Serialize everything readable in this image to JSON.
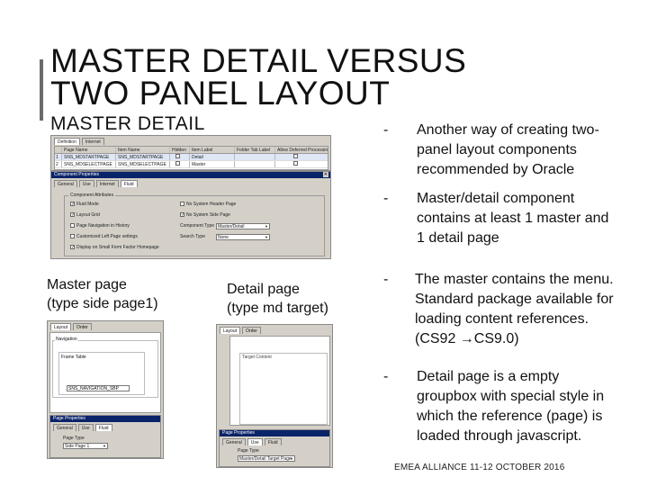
{
  "slide": {
    "title_line1": "MASTER DETAIL VERSUS",
    "title_line2": "TWO PANEL LAYOUT",
    "subtitle": "MASTER DETAIL",
    "footer": "EMEA ALLIANCE   11-12 OCTOBER 2016"
  },
  "screenshot_master": {
    "tabs": [
      "Definition",
      "Internet"
    ],
    "grid_headers": [
      "",
      "Page Name",
      "Item Name",
      "Hidden",
      "Item Label",
      "Folder Tab Label",
      "Allow Deferred Processing"
    ],
    "grid_rows": [
      [
        "1",
        "SNS_MDSTARTPAGE",
        "SNS_MDSTARTPAGE",
        "",
        "Detail",
        "",
        ""
      ],
      [
        "2",
        "SNS_MDSELECTPAGE",
        "SNS_MDSELECTPAGE",
        "",
        "Master",
        "",
        ""
      ]
    ],
    "dialog_title": "Component Properties",
    "dialog_tabs": [
      "General",
      "Use",
      "Internet",
      "Fluid"
    ],
    "group_label": "Component Attributes",
    "left_checks": [
      {
        "label": "Fluid Mode",
        "checked": true
      },
      {
        "label": "Layout Grid",
        "checked": true
      },
      {
        "label": "Page Navigation in History",
        "checked": false
      },
      {
        "label": "Customized Left Page settings",
        "checked": false
      },
      {
        "label": "Display on Small Form Factor Homepage",
        "checked": true
      }
    ],
    "right_checks": [
      {
        "label": "No System Header Page",
        "checked": false
      },
      {
        "label": "No System Side Page",
        "checked": true
      }
    ],
    "component_type_label": "Component Type",
    "component_type_value": "Master/Detail",
    "search_type_label": "Search Type",
    "search_type_value": "None"
  },
  "labels": {
    "master_line1": "Master page",
    "master_line2": "(type side page1)",
    "detail_line1": "Detail page",
    "detail_line2": "(type md target)"
  },
  "thumb_master": {
    "tabs": [
      "Layout",
      "Order"
    ],
    "navigation_label": "Navigation",
    "frame_label": "Frame Table",
    "field_value": "SNS_NAVIGATION_SBP",
    "dialog_title": "Page Properties",
    "dialog_tabs": [
      "General",
      "Use",
      "Fluid"
    ],
    "page_type_label": "Page Type",
    "page_type_value": "Side Page 1"
  },
  "thumb_detail": {
    "tabs": [
      "Layout",
      "Order"
    ],
    "groupbox_label": "Target Content",
    "dialog_title": "Page Properties",
    "dialog_tabs": [
      "General",
      "Use",
      "Fluid"
    ],
    "page_type_label": "Page Type",
    "page_type_value": "Master/Detail Target Page"
  },
  "bullets": [
    {
      "dash": "-",
      "text": "Another way of creating two-panel layout components recommended by Oracle"
    },
    {
      "dash": "-",
      "text": "Master/detail component contains at least  1 master and 1 detail page"
    },
    {
      "dash": "-",
      "text": "The master contains the menu. Standard package available for loading content references. (CS92 →CS9.0)"
    },
    {
      "dash": "-",
      "text": "Detail page is a empty groupbox with special style in which the reference (page) is loaded through javascript."
    }
  ]
}
